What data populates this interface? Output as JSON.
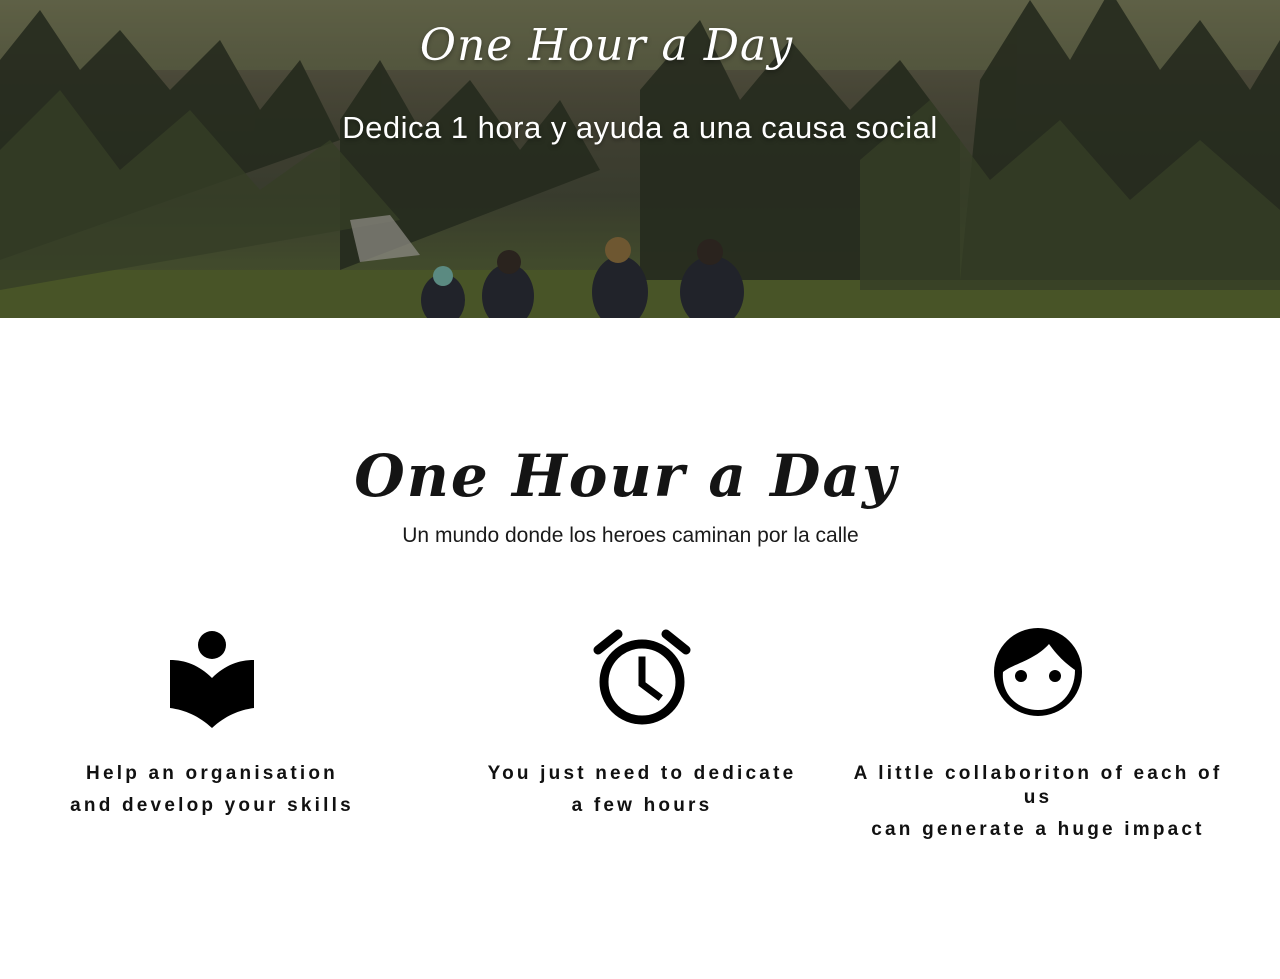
{
  "hero": {
    "title": "One Hour a Day",
    "subtitle": "Dedica 1 hora y ayuda a una causa social"
  },
  "main": {
    "title": "One Hour a Day",
    "subtitle": "Un mundo donde los heroes caminan por la calle"
  },
  "features": [
    {
      "icon": "book-reader-icon",
      "lines": [
        "Help an organisation",
        "and develop your skills"
      ]
    },
    {
      "icon": "alarm-clock-icon",
      "lines": [
        "You just need to dedicate",
        "a few hours"
      ]
    },
    {
      "icon": "face-icon",
      "lines": [
        "A little collaboriton of each of us",
        "can generate a huge impact"
      ]
    }
  ],
  "colors": {
    "icon": "#000000",
    "text": "#111111",
    "background": "#ffffff"
  }
}
